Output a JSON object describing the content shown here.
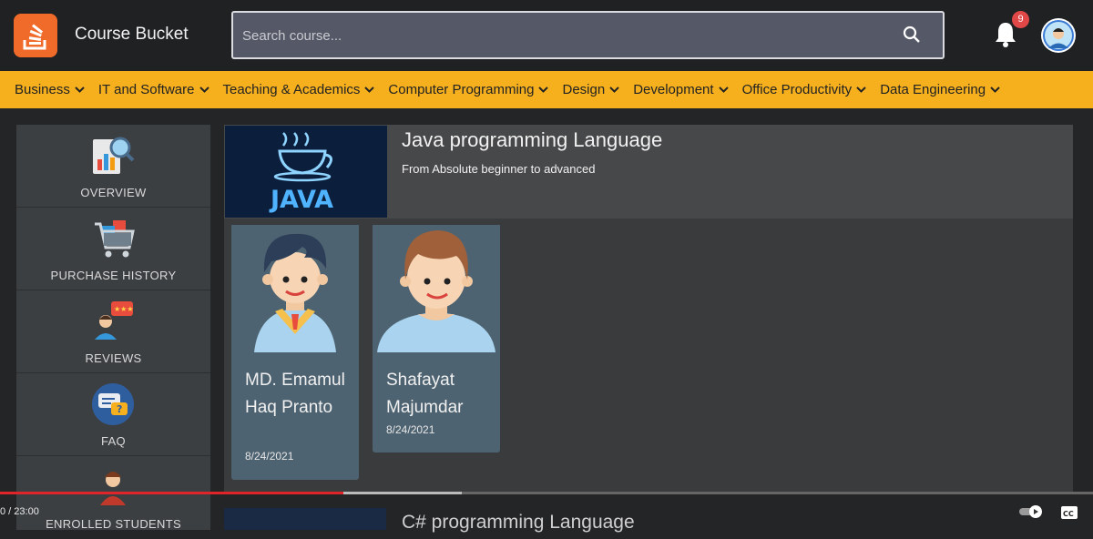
{
  "app": {
    "brand": "Course Bucket",
    "logo_icon": "stack-overflow-logo-icon",
    "accent": "#f6b01e"
  },
  "search": {
    "placeholder": "Search course..."
  },
  "notifications": {
    "count": "9"
  },
  "categories": [
    "Business",
    "IT and Software",
    "Teaching & Academics",
    "Computer Programming",
    "Design",
    "Development",
    "Office Productivity",
    "Data Engineering"
  ],
  "sidebar": {
    "items": [
      {
        "label": "OVERVIEW",
        "icon": "analytics-icon"
      },
      {
        "label": "PURCHASE HISTORY",
        "icon": "shopping-cart-icon"
      },
      {
        "label": "REVIEWS",
        "icon": "reviews-icon"
      },
      {
        "label": "FAQ",
        "icon": "faq-icon"
      },
      {
        "label": "ENROLLED STUDENTS",
        "icon": "student-icon"
      }
    ]
  },
  "course": {
    "title": "Java programming Language",
    "subtitle": "From Absolute beginner to advanced",
    "thumbnail_text": "JAVA",
    "students": [
      {
        "name": "MD. Emamul Haq Pranto",
        "date": "8/24/2021"
      },
      {
        "name": "Shafayat Majumdar",
        "date": "8/24/2021"
      }
    ]
  },
  "next_course": {
    "title": "C# programming Language"
  },
  "video": {
    "time": "0 / 23:00",
    "played": 0.314
  }
}
